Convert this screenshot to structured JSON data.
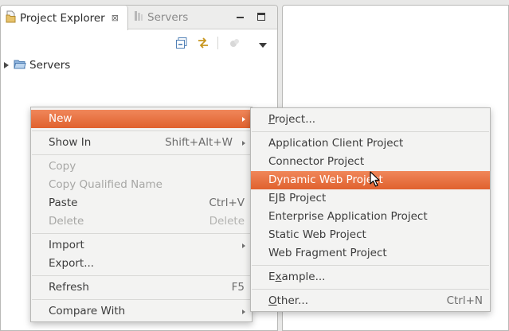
{
  "colors": {
    "highlight": "#e8703d",
    "menu_bg": "#f3f3f2",
    "disabled_text": "#a7a7a5",
    "folder_icon": "#5f8fc5"
  },
  "view": {
    "tabs": [
      {
        "label": "Project Explorer",
        "icon": "project-explorer-icon",
        "close": "⊠"
      },
      {
        "label": "Servers",
        "icon": "servers-icon"
      }
    ],
    "tree": [
      {
        "label": "Servers",
        "icon": "folder-icon",
        "expanded": false
      }
    ]
  },
  "context_menu": {
    "items": [
      {
        "key": "new",
        "label": "New",
        "submenu": true,
        "highlighted": true
      },
      {
        "key": "show_in",
        "label": "Show In",
        "accel": "Shift+Alt+W",
        "submenu": true
      },
      {
        "key": "copy",
        "label": "Copy",
        "disabled": true
      },
      {
        "key": "copy_qn",
        "label": "Copy Qualified Name",
        "disabled": true
      },
      {
        "key": "paste",
        "label": "Paste",
        "accel": "Ctrl+V"
      },
      {
        "key": "delete",
        "label": "Delete",
        "accel": "Delete",
        "disabled": true
      },
      {
        "key": "import",
        "label": "Import",
        "submenu": true
      },
      {
        "key": "export",
        "label": "Export..."
      },
      {
        "key": "refresh",
        "label": "Refresh",
        "accel": "F5"
      },
      {
        "key": "compare",
        "label": "Compare With",
        "submenu": true
      }
    ]
  },
  "new_submenu": {
    "items": [
      {
        "key": "project",
        "mnemonic": "P",
        "rest": "roject..."
      },
      {
        "key": "app_client",
        "label": "Application Client Project"
      },
      {
        "key": "connector",
        "label": "Connector Project"
      },
      {
        "key": "dynamic_web",
        "label": "Dynamic Web Project",
        "highlighted": true
      },
      {
        "key": "ejb",
        "label": "EJB Project"
      },
      {
        "key": "enterprise",
        "label": "Enterprise Application Project"
      },
      {
        "key": "static_web",
        "label": "Static Web Project"
      },
      {
        "key": "web_fragment",
        "label": "Web Fragment Project"
      },
      {
        "key": "example",
        "mnemonic_pre": "E",
        "mnemonic": "x",
        "rest": "ample..."
      },
      {
        "key": "other",
        "mnemonic": "O",
        "rest": "ther...",
        "accel": "Ctrl+N"
      }
    ]
  }
}
